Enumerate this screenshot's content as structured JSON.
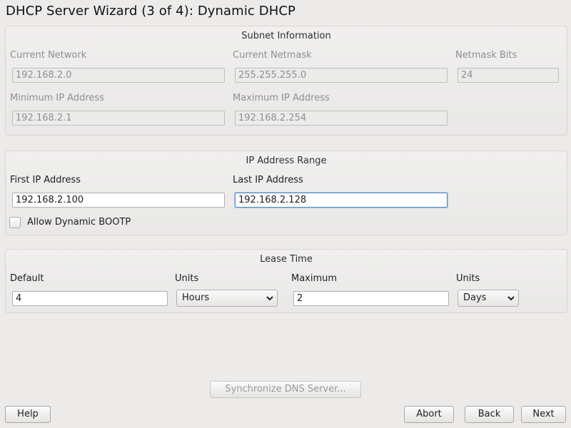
{
  "window": {
    "title": "DHCP Server Wizard (3 of 4): Dynamic DHCP"
  },
  "subnet": {
    "title": "Subnet Information",
    "current_network_label": "Current Network",
    "current_network_value": "192.168.2.0",
    "current_netmask_label": "Current Netmask",
    "current_netmask_value": "255.255.255.0",
    "netmask_bits_label": "Netmask Bits",
    "netmask_bits_value": "24",
    "min_ip_label": "Minimum IP Address",
    "min_ip_value": "192.168.2.1",
    "max_ip_label": "Maximum IP Address",
    "max_ip_value": "192.168.2.254"
  },
  "range": {
    "title": "IP Address Range",
    "first_ip_label": "First IP Address",
    "first_ip_value": "192.168.2.100",
    "last_ip_label": "Last IP Address",
    "last_ip_value": "192.168.2.128",
    "allow_bootp_label": "Allow Dynamic BOOTP",
    "allow_bootp_checked": false
  },
  "lease": {
    "title": "Lease Time",
    "default_label": "Default",
    "default_value": "4",
    "default_units_label": "Units",
    "default_units_value": "Hours",
    "maximum_label": "Maximum",
    "maximum_value": "2",
    "maximum_units_label": "Units",
    "maximum_units_value": "Days"
  },
  "buttons": {
    "sync_dns": "Synchronize DNS Server...",
    "help": "Help",
    "abort": "Abort",
    "back": "Back",
    "next": "Next"
  }
}
